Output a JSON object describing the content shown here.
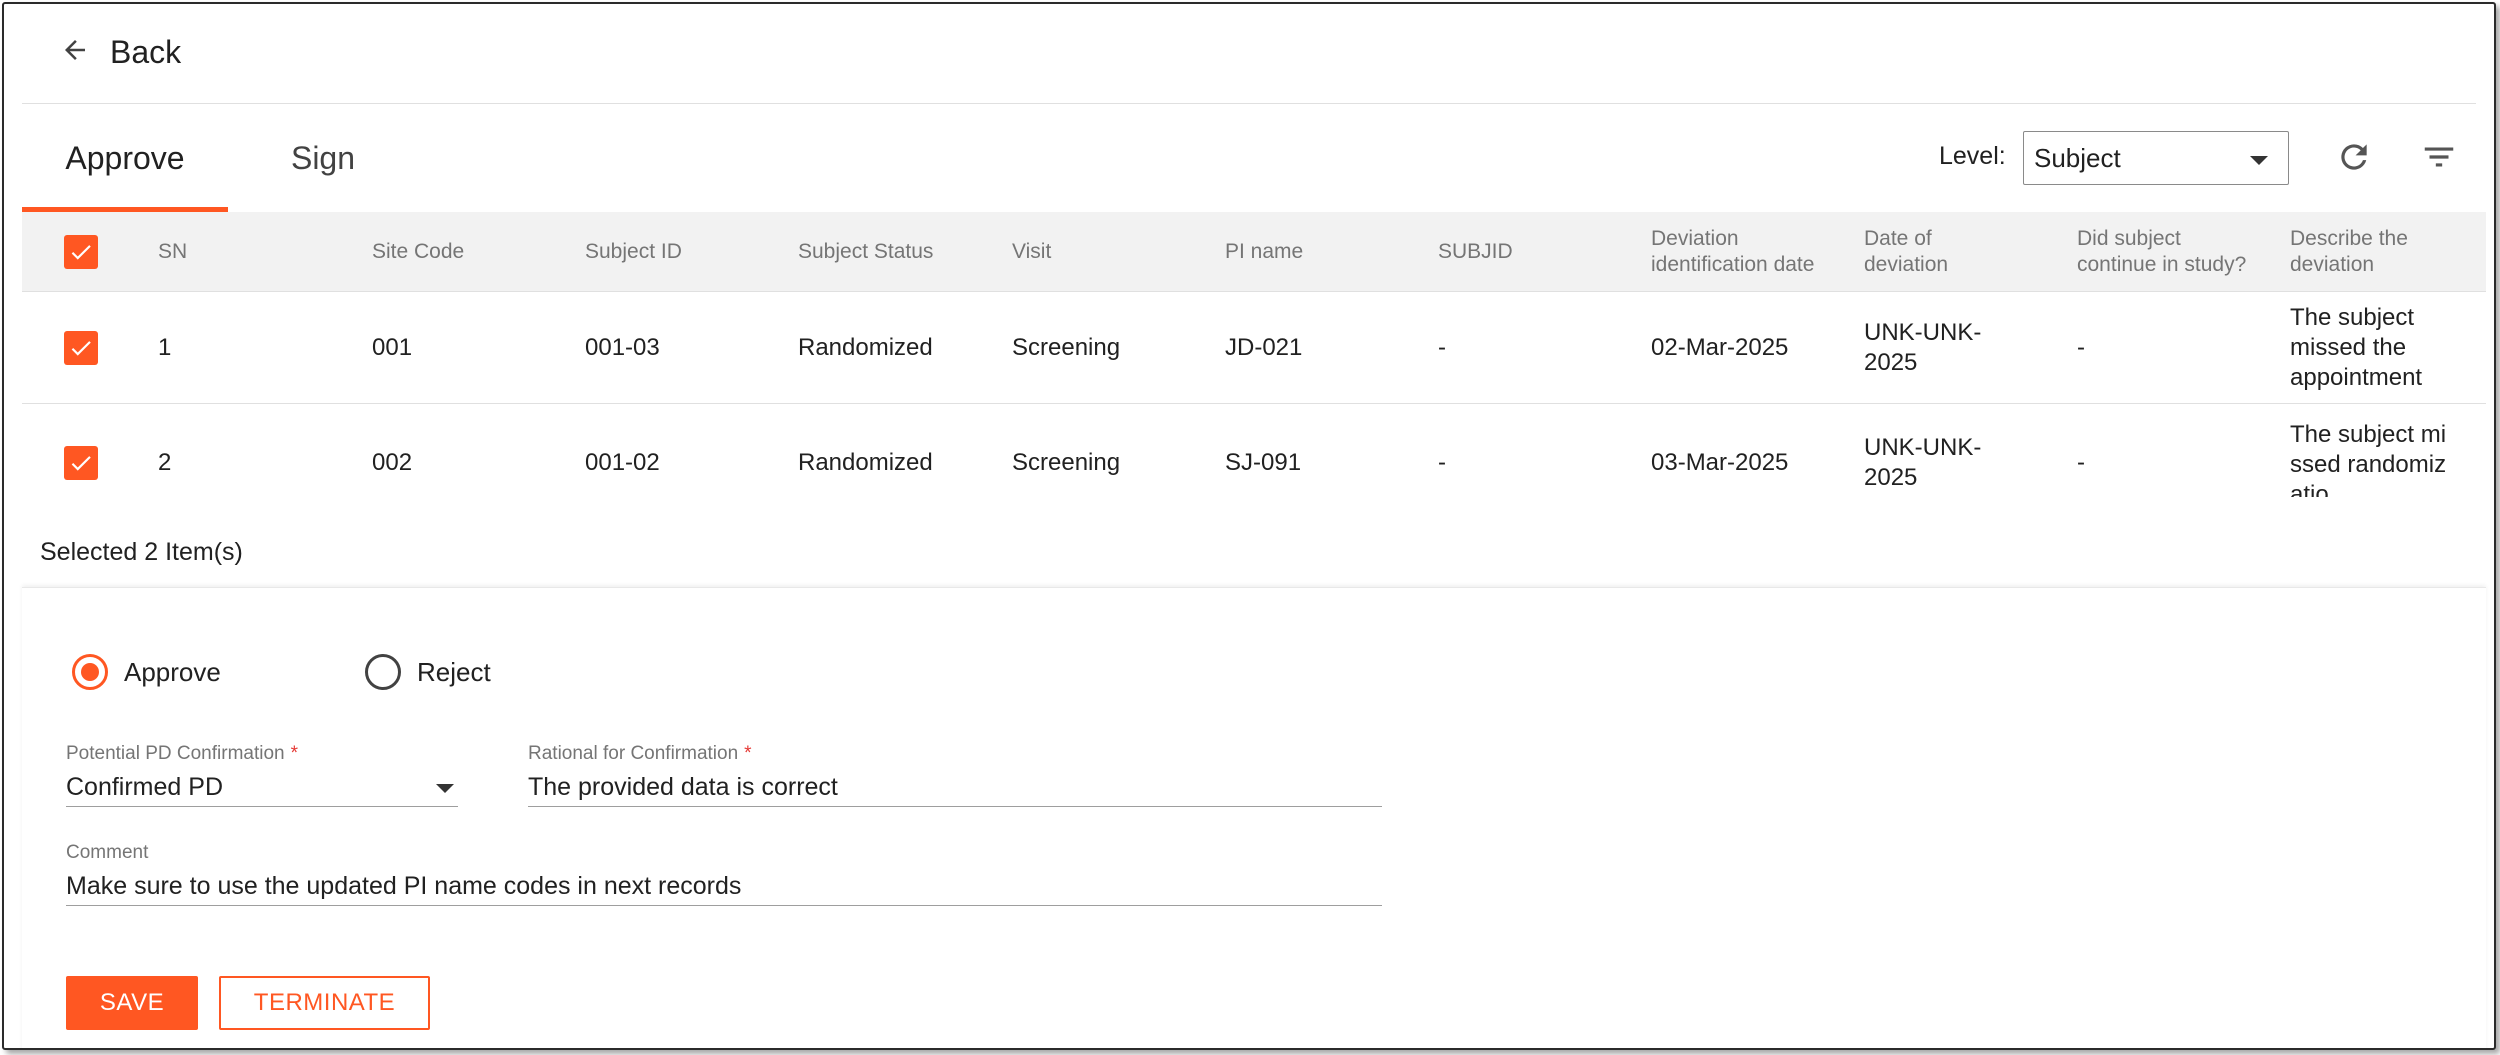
{
  "header": {
    "back_label": "Back"
  },
  "tabs": [
    {
      "label": "Approve",
      "active": true
    },
    {
      "label": "Sign",
      "active": false
    }
  ],
  "level": {
    "label": "Level:",
    "value": "Subject"
  },
  "table": {
    "columns": [
      "SN",
      "Site Code",
      "Subject ID",
      "Subject Status",
      "Visit",
      "PI name",
      "SUBJID",
      "Deviation identification date",
      "Date of deviation",
      "Did subject continue in study?",
      "Describe the deviation"
    ],
    "rows": [
      {
        "checked": true,
        "sn": "1",
        "site_code": "001",
        "subject_id": "001-03",
        "subject_status": "Randomized",
        "visit": "Screening",
        "pi_name": "JD-021",
        "subjid": "-",
        "deviation_identification_date": "02-Mar-2025",
        "date_of_deviation": "UNK-UNK-2025",
        "continue_in_study": "-",
        "description": "The subject missed the appointment"
      },
      {
        "checked": true,
        "sn": "2",
        "site_code": "002",
        "subject_id": "001-02",
        "subject_status": "Randomized",
        "visit": "Screening",
        "pi_name": "SJ-091",
        "subjid": "-",
        "deviation_identification_date": "03-Mar-2025",
        "date_of_deviation": "UNK-UNK-2025",
        "continue_in_study": "-",
        "description": "The subject missed randomizatio"
      }
    ]
  },
  "selection": {
    "text": "Selected 2 Item(s)"
  },
  "form": {
    "decision_options": [
      {
        "label": "Approve",
        "checked": true
      },
      {
        "label": "Reject",
        "checked": false
      }
    ],
    "potential_pd": {
      "label": "Potential PD Confirmation",
      "required_mark": "*",
      "value": "Confirmed PD"
    },
    "rationale": {
      "label": "Rational for Confirmation",
      "required_mark": "*",
      "value": "The provided data is correct"
    },
    "comment": {
      "label": "Comment",
      "value": "Make sure to use the updated PI name codes in next records"
    },
    "save_label": "SAVE",
    "terminate_label": "TERMINATE"
  },
  "colors": {
    "accent": "#ff5722",
    "header_bg": "#f2f2f2",
    "text": "#212121",
    "muted": "#757575"
  },
  "icons": [
    "arrow-left-icon",
    "refresh-icon",
    "filter-icon",
    "checkbox-checked-icon",
    "chevron-down-icon"
  ]
}
